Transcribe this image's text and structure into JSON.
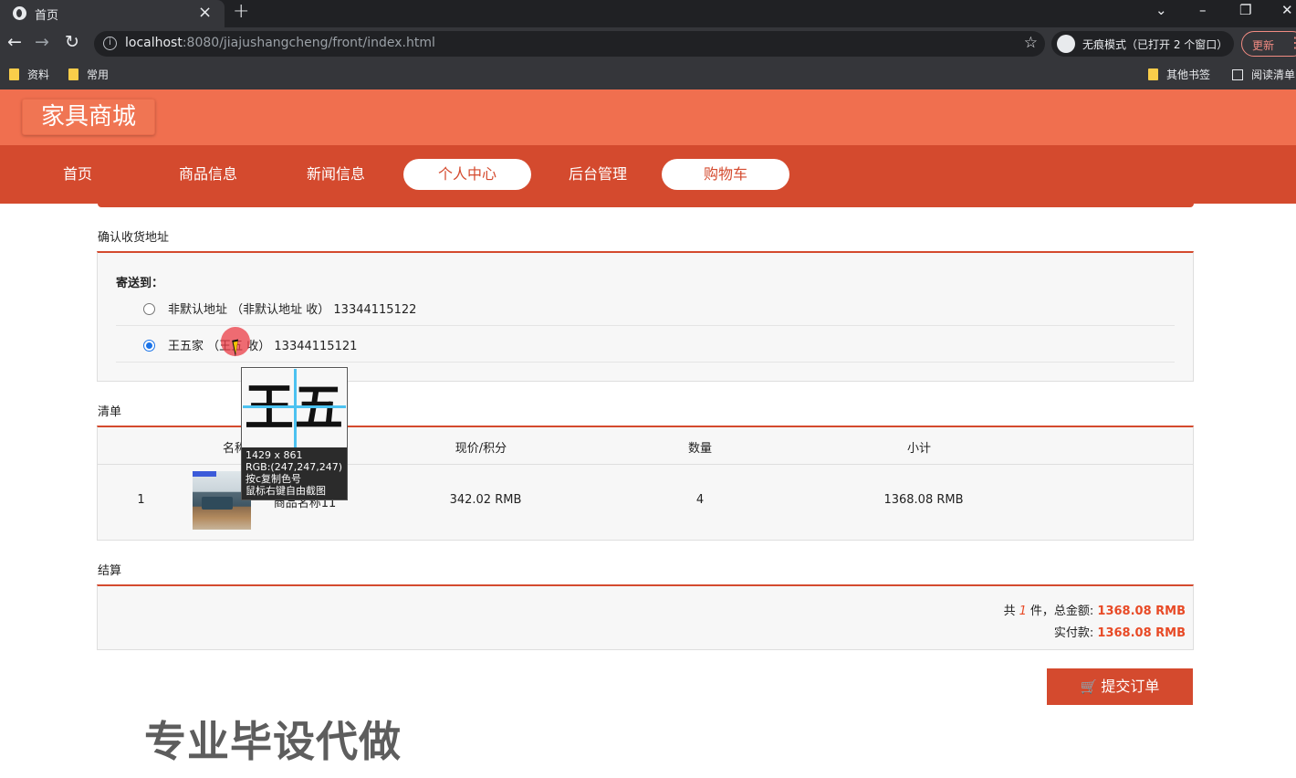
{
  "browser": {
    "tab_title": "首页",
    "url_host": "localhost",
    "url_rest": ":8080/jiajushangcheng/front/index.html",
    "incognito_label": "无痕模式（已打开 2 个窗口）",
    "update_label": "更新",
    "bookmarks": [
      "资料",
      "常用",
      "其他书签",
      "阅读清单"
    ]
  },
  "site": {
    "logo": "家具商城",
    "nav": [
      "首页",
      "商品信息",
      "新闻信息",
      "个人中心",
      "后台管理",
      "购物车"
    ],
    "active_nav": "个人中心",
    "accent_color": "#d44a2e",
    "header_color": "#f06f4f"
  },
  "address": {
    "section_title": "确认收货地址",
    "ship_label": "寄送到：",
    "options": [
      {
        "text": "非默认地址 （非默认地址 收） 13344115122",
        "selected": false
      },
      {
        "text": "王五家 （王五 收） 13344115121",
        "selected": true
      }
    ]
  },
  "list": {
    "section_title": "清单",
    "headers": [
      "名称",
      "现价/积分",
      "数量",
      "小计"
    ],
    "rows": [
      {
        "index": "1",
        "name": "商品名称11",
        "price": "342.02 RMB",
        "qty": "4",
        "subtotal": "1368.08 RMB"
      }
    ]
  },
  "checkout": {
    "section_title": "结算",
    "count_prefix": "共",
    "count": "1",
    "count_suffix": "件，总金额:",
    "total": "1368.08 RMB",
    "paid_label": "实付款:",
    "paid": "1368.08 RMB",
    "submit_label": "提交订单"
  },
  "watermark": "专业毕设代做",
  "picker": {
    "glyphs": "王五",
    "size": "1429 x 861",
    "rgb": "RGB:(247,247,247)",
    "hint1": "按c复制色号",
    "hint2": "鼠标右键自由截图"
  }
}
